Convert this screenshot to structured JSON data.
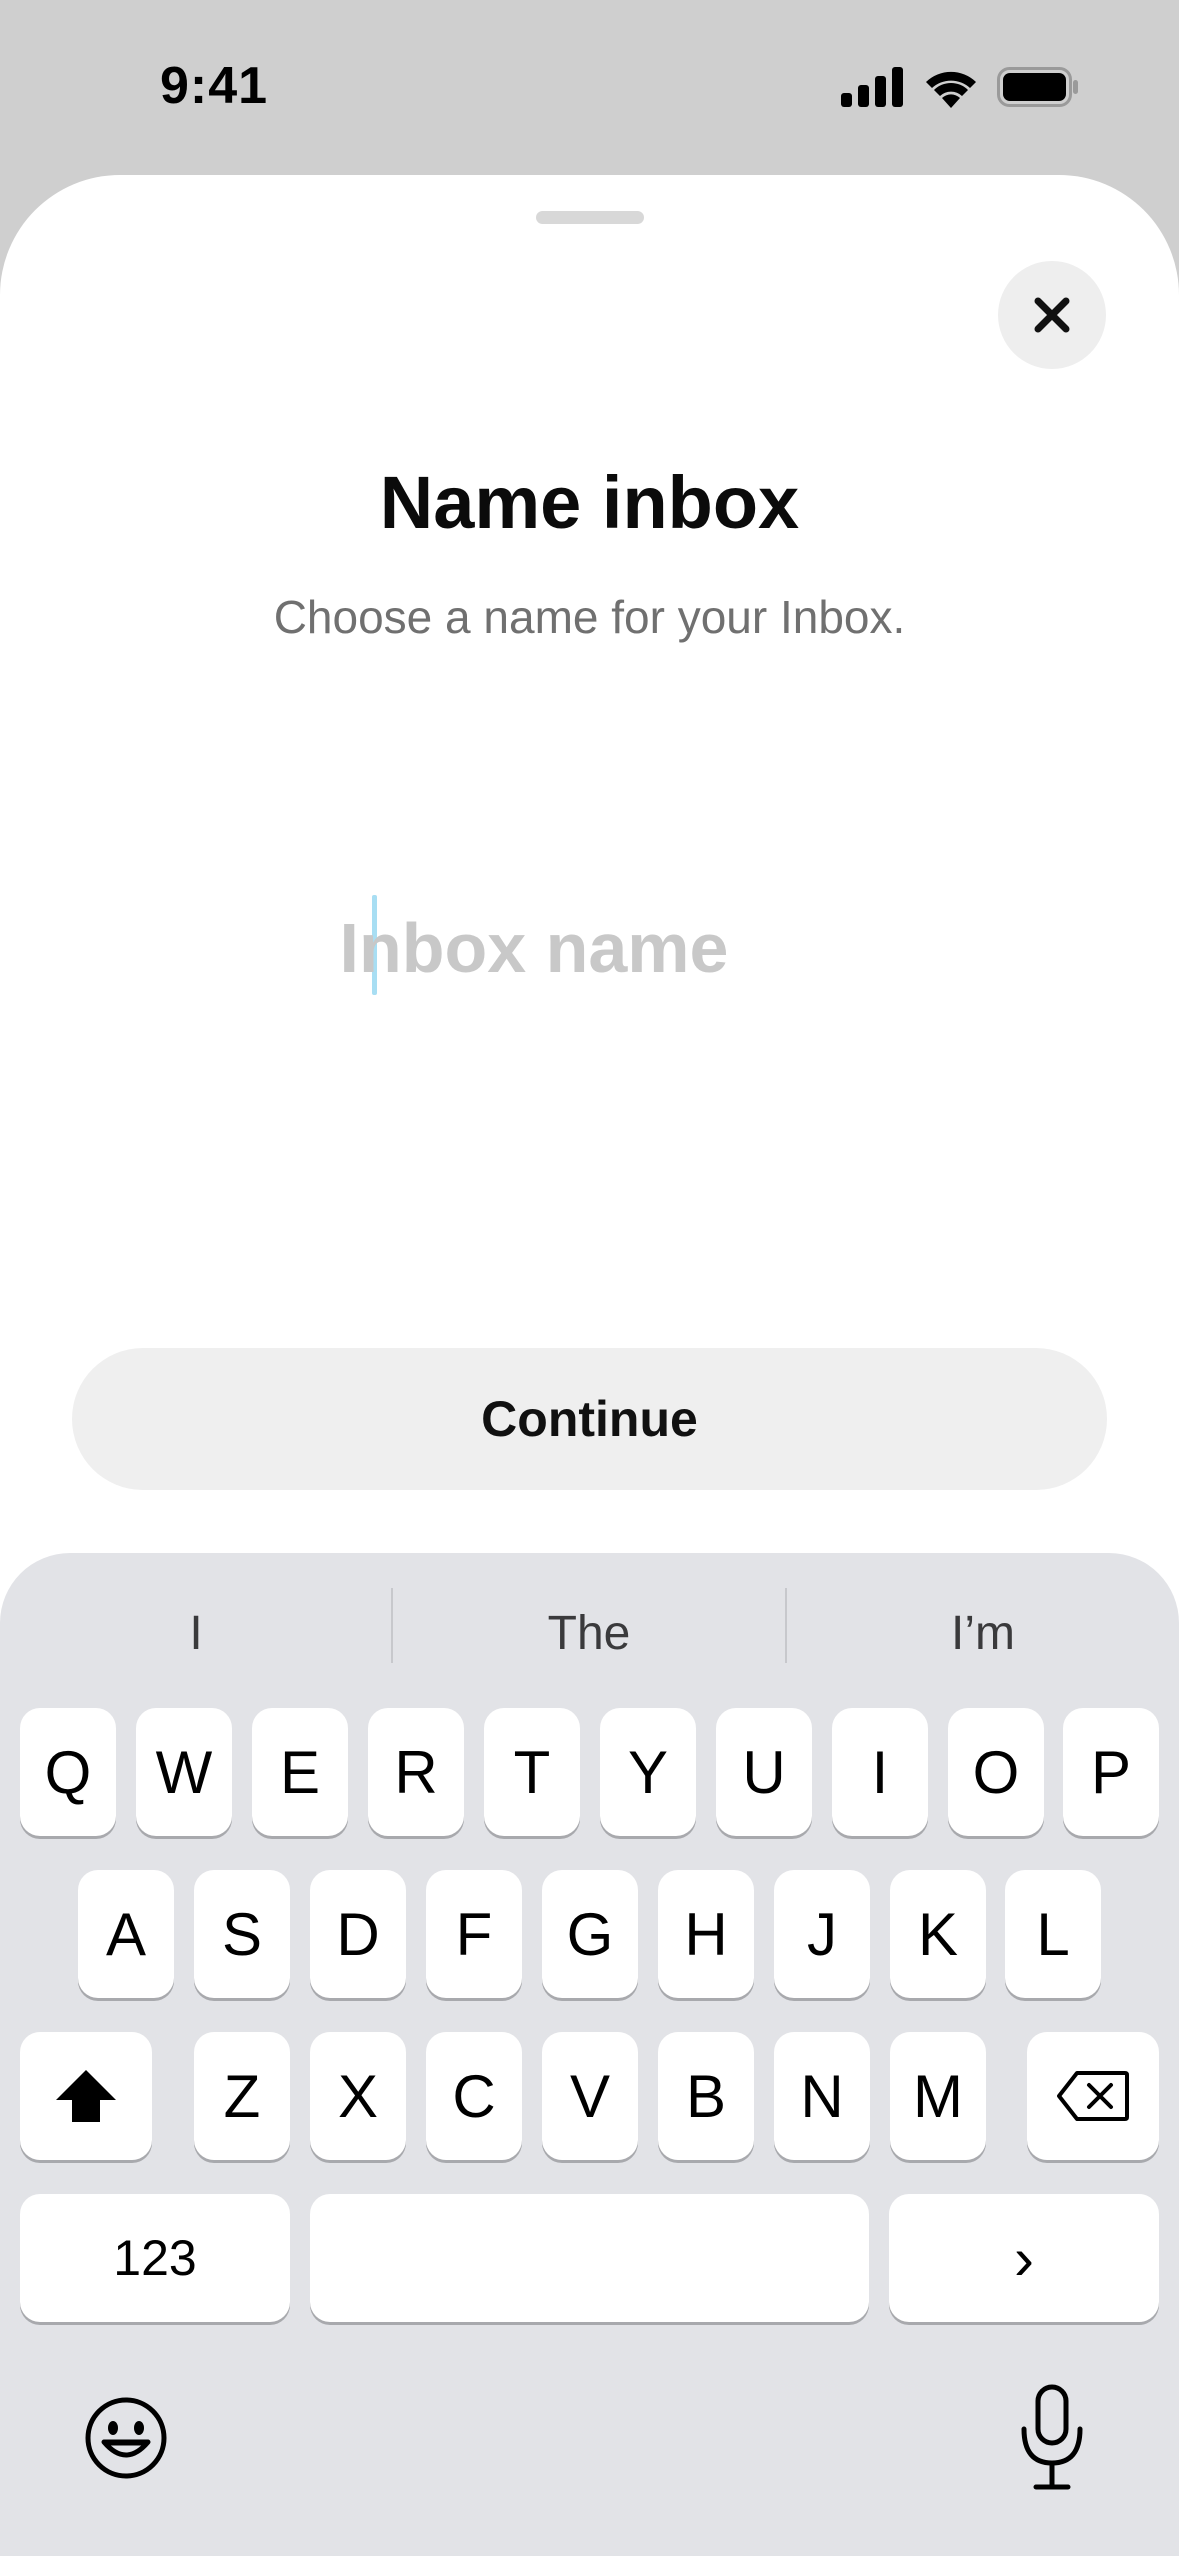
{
  "status_bar": {
    "time": "9:41",
    "icons": [
      "cellular-icon",
      "wifi-icon",
      "battery-icon"
    ]
  },
  "sheet": {
    "close_icon": "close-icon",
    "title": "Name inbox",
    "subtitle": "Choose a name for your Inbox.",
    "input": {
      "value": "",
      "placeholder": "Inbox name"
    },
    "continue_label": "Continue"
  },
  "keyboard": {
    "suggestions": [
      "I",
      "The",
      "I’m"
    ],
    "row1": [
      "Q",
      "W",
      "E",
      "R",
      "T",
      "Y",
      "U",
      "I",
      "O",
      "P"
    ],
    "row2": [
      "A",
      "S",
      "D",
      "F",
      "G",
      "H",
      "J",
      "K",
      "L"
    ],
    "row3": [
      "Z",
      "X",
      "C",
      "V",
      "B",
      "N",
      "M"
    ],
    "numbers_label": "123",
    "return_label": "›",
    "icons": [
      "shift-icon",
      "backspace-icon",
      "emoji-icon",
      "microphone-icon"
    ]
  }
}
